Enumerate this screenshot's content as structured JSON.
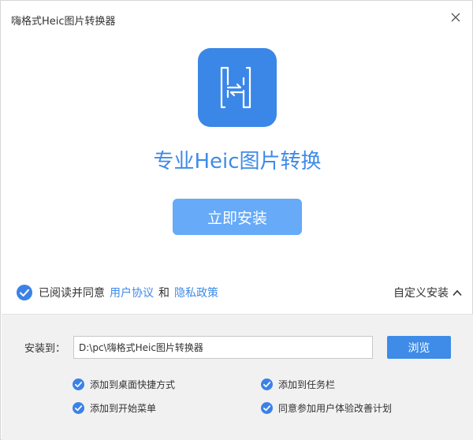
{
  "window": {
    "title": "嗨格式Heic图片转换器",
    "close_icon": "close-icon"
  },
  "hero": {
    "logo_icon": "heic-logo-icon",
    "tagline": "专业Heic图片转换",
    "install_label": "立即安装",
    "accent_color": "#3e8be8",
    "button_color": "#66aaf8"
  },
  "agreement": {
    "checked": true,
    "prefix": "已阅读并同意",
    "user_agreement": "用户协议",
    "and": "和",
    "privacy_policy": "隐私政策"
  },
  "custom_install": {
    "label": "自定义安装",
    "chevron_icon": "chevron-up-icon"
  },
  "install_options": {
    "path_label": "安装到：",
    "path_value": "D:\\pc\\嗨格式Heic图片转换器",
    "browse_label": "浏览",
    "options": [
      {
        "label": "添加到桌面快捷方式",
        "checked": true
      },
      {
        "label": "添加到任务栏",
        "checked": true
      },
      {
        "label": "添加到开始菜单",
        "checked": true
      },
      {
        "label": "同意参加用户体验改善计划",
        "checked": true
      }
    ]
  }
}
